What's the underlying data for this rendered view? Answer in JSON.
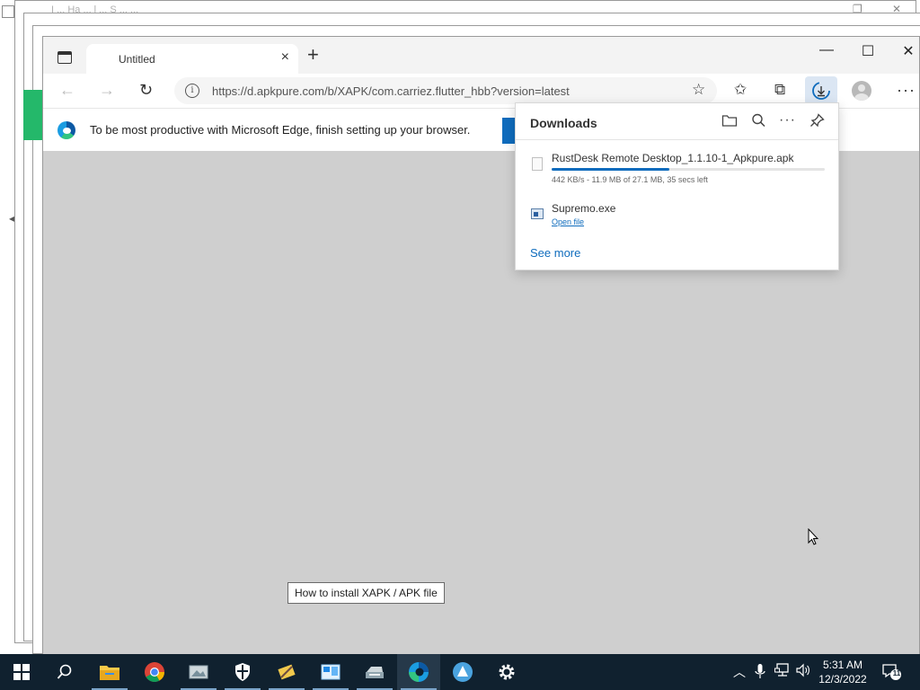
{
  "background_windows": {
    "title_fragment": "I ... Ha ... l ... S ... ..."
  },
  "browser": {
    "tab": {
      "title": "Untitled",
      "close": "×"
    },
    "new_tab": "+",
    "window_controls": {
      "minimize": "—",
      "maximize": "☐",
      "close": "✕"
    },
    "address": {
      "url": "https://d.apkpure.com/b/XAPK/com.carriez.flutter_hbb?version=latest",
      "info": "i"
    },
    "infobar": {
      "message": "To be most productive with Microsoft Edge, finish setting up your browser."
    },
    "more_menu": "···"
  },
  "downloads": {
    "title": "Downloads",
    "more": "···",
    "items": [
      {
        "name": "RustDesk Remote Desktop_1.1.10-1_Apkpure.apk",
        "status": "442 KB/s - 11.9 MB of 27.1 MB, 35 secs left",
        "progress": 0.43
      },
      {
        "name": "Supremo.exe",
        "action": "Open file"
      }
    ],
    "see_more": "See more"
  },
  "page": {
    "tooltip": "How to install XAPK / APK file"
  },
  "taskbar": {
    "time": "5:31 AM",
    "date": "12/3/2022",
    "notification_count": "11",
    "pinned": [
      "start",
      "search",
      "file-explorer",
      "chrome",
      "image-viewer",
      "security",
      "tool",
      "remote-app",
      "printer",
      "edge",
      "app-store",
      "settings"
    ]
  },
  "colors": {
    "accent": "#0f6cbd",
    "taskbar": "#10212f",
    "page_bg": "#cfcfcf"
  }
}
